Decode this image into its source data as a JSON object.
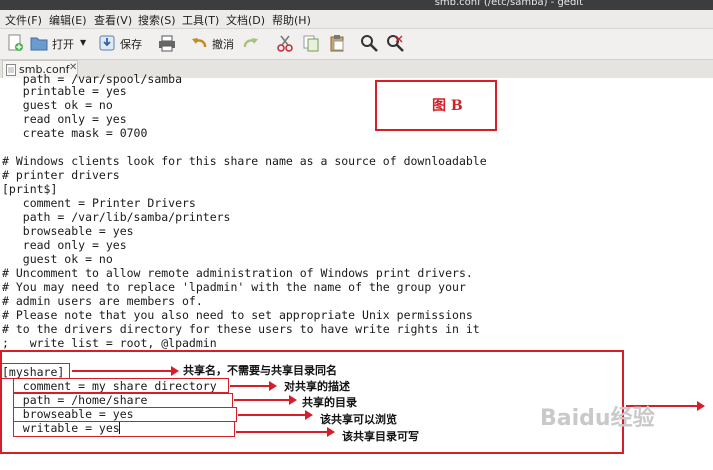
{
  "window": {
    "title": "smb.conf (/etc/samba) - gedit"
  },
  "menu": [
    "文件(F)",
    "编辑(E)",
    "查看(V)",
    "搜索(S)",
    "工具(T)",
    "文档(D)",
    "帮助(H)"
  ],
  "toolbar": {
    "open_label": "打开",
    "save_label": "保存",
    "undo_label": "撤消"
  },
  "tab": {
    "name": "smb.conf"
  },
  "lines": [
    "   path = /var/spool/samba",
    "   printable = yes",
    "   guest ok = no",
    "   read only = yes",
    "   create mask = 0700",
    "",
    "# Windows clients look for this share name as a source of downloadable",
    "# printer drivers",
    "[print$]",
    "   comment = Printer Drivers",
    "   path = /var/lib/samba/printers",
    "   browseable = yes",
    "   read only = yes",
    "   guest ok = no",
    "# Uncomment to allow remote administration of Windows print drivers.",
    "# You may need to replace 'lpadmin' with the name of the group your",
    "# admin users are members of.",
    "# Please note that you also need to set appropriate Unix permissions",
    "# to the drivers directory for these users to have write rights in it",
    ";   write list = root, @lpadmin",
    "",
    "[myshare]",
    "   comment = my share directory",
    "   path = /home/share",
    "   browseable = yes",
    "   writable = yes"
  ],
  "annotations": {
    "figure_label": "图 B",
    "share_name": "共享名，不需要与共享目录同名",
    "comment_desc": "对共享的描述",
    "path_desc": "共享的目录",
    "browse_desc": "该共享可以浏览",
    "write_desc": "该共享目录可写"
  },
  "watermark": "Baidu经验",
  "colors": {
    "accent_red": "#d61e28",
    "menu_bg": "#ecebe9",
    "titlebar_bg": "#3b3d3f"
  }
}
